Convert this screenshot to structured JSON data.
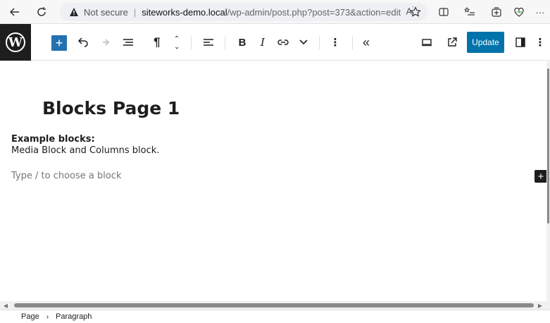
{
  "browser": {
    "address": {
      "security_label": "Not secure",
      "host": "siteworks-demo.local",
      "path": "/wp-admin/post.php?post=373&action=edit"
    }
  },
  "toolbar": {
    "update_label": "Update"
  },
  "editor": {
    "post_title": "Blocks Page 1",
    "paragraph_bold": "Example blocks:",
    "paragraph_text": "Media Block and Columns block.",
    "block_placeholder": "Type / to choose a block"
  },
  "breadcrumb": {
    "items": [
      "Page",
      "Paragraph"
    ]
  },
  "colors": {
    "wp_logo_bg": "#1e1e1e",
    "inserter_blue": "#2271b1",
    "update_blue": "#0073aa"
  }
}
